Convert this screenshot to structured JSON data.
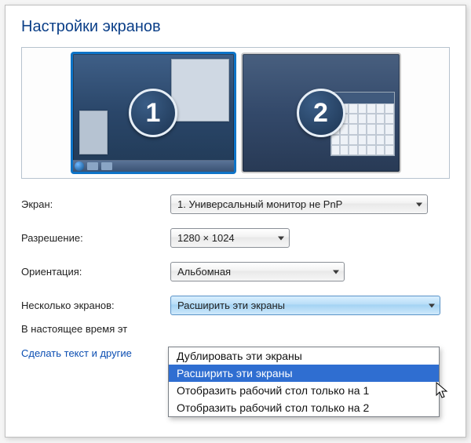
{
  "title": "Настройки экранов",
  "monitors": {
    "primary_badge": "1",
    "secondary_badge": "2"
  },
  "labels": {
    "display": "Экран:",
    "resolution": "Разрешение:",
    "orientation": "Ориентация:",
    "multiple": "Несколько экранов:",
    "currently_prefix": "В настоящее время эт",
    "link_prefix": "Сделать текст и другие"
  },
  "dropdowns": {
    "display": {
      "value": "1. Универсальный монитор не PnP"
    },
    "resolution": {
      "value": "1280 × 1024"
    },
    "orientation": {
      "value": "Альбомная"
    },
    "multiple": {
      "value": "Расширить эти экраны",
      "options": [
        "Дублировать эти экраны",
        "Расширить эти экраны",
        "Отобразить рабочий стол только на 1",
        "Отобразить рабочий стол только на 2"
      ],
      "selected_index": 1
    }
  }
}
